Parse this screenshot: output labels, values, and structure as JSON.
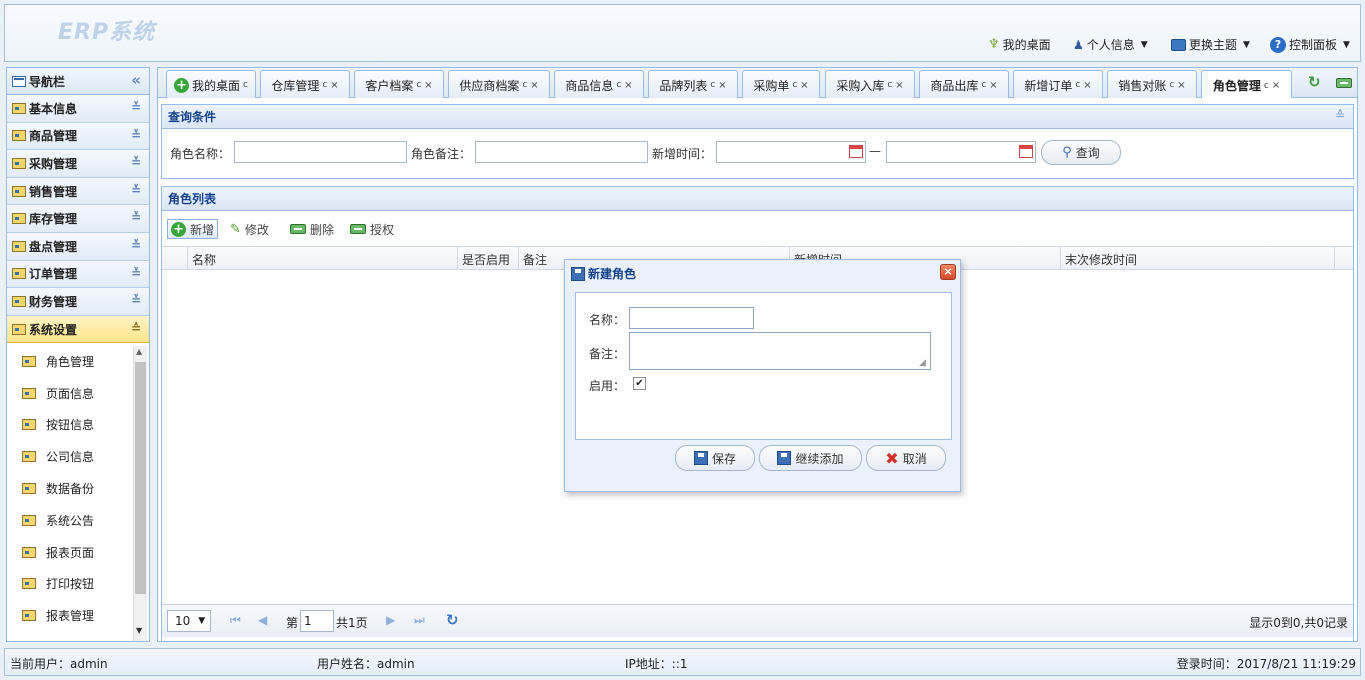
{
  "app": {
    "title": "ERP系统"
  },
  "header": {
    "links": [
      {
        "label": "我的桌面",
        "icon": "trophy-icon"
      },
      {
        "label": "个人信息",
        "icon": "user-icon"
      },
      {
        "label": "更换主题",
        "icon": "monitor-icon"
      },
      {
        "label": "控制面板",
        "icon": "help-icon"
      }
    ]
  },
  "sidebar": {
    "title": "导航栏",
    "collapse_glyph": "«",
    "groups": [
      {
        "label": "基本信息"
      },
      {
        "label": "商品管理"
      },
      {
        "label": "采购管理"
      },
      {
        "label": "销售管理"
      },
      {
        "label": "库存管理"
      },
      {
        "label": "盘点管理"
      },
      {
        "label": "订单管理"
      },
      {
        "label": "财务管理"
      },
      {
        "label": "系统设置"
      }
    ],
    "active_group": "系统设置",
    "sub_items": [
      {
        "label": "角色管理"
      },
      {
        "label": "页面信息"
      },
      {
        "label": "按钮信息"
      },
      {
        "label": "公司信息"
      },
      {
        "label": "数据备份"
      },
      {
        "label": "系统公告"
      },
      {
        "label": "报表页面"
      },
      {
        "label": "打印按钮"
      },
      {
        "label": "报表管理"
      }
    ]
  },
  "tabs": [
    {
      "label": "我的桌面",
      "closable": false
    },
    {
      "label": "仓库管理",
      "closable": true
    },
    {
      "label": "客户档案",
      "closable": true
    },
    {
      "label": "供应商档案",
      "closable": true
    },
    {
      "label": "商品信息",
      "closable": true
    },
    {
      "label": "品牌列表",
      "closable": true
    },
    {
      "label": "采购单",
      "closable": true
    },
    {
      "label": "采购入库",
      "closable": true
    },
    {
      "label": "商品出库",
      "closable": true
    },
    {
      "label": "新增订单",
      "closable": true
    },
    {
      "label": "销售对账",
      "closable": true
    },
    {
      "label": "角色管理",
      "closable": true,
      "active": true
    }
  ],
  "tab_glyphs": {
    "refresh": "c",
    "close": "×"
  },
  "query": {
    "title": "查询条件",
    "name_label": "角色名称：",
    "note_label": "角色备注：",
    "time_label": "新增时间：",
    "range_sep": "—",
    "search_button": "查询"
  },
  "list": {
    "title": "角色列表",
    "toolbar": {
      "add": "新增",
      "edit": "修改",
      "delete": "删除",
      "grant": "授权"
    },
    "columns": [
      "名称",
      "是否启用",
      "备注",
      "新增时间",
      "末次修改时间"
    ]
  },
  "pager": {
    "page_size": "10",
    "page_prefix": "第",
    "page_value": "1",
    "page_suffix": "共1页",
    "summary": "显示0到0,共0记录"
  },
  "dialog": {
    "title": "新建角色",
    "name_label": "名称：",
    "name_value": "",
    "note_label": "备注：",
    "note_value": "",
    "enable_label": "启用：",
    "enable_checked": true,
    "save": "保存",
    "save_continue": "继续添加",
    "cancel": "取消"
  },
  "status": {
    "current_user": "当前用户：admin",
    "user_name": "用户姓名：admin",
    "ip": "IP地址：::1",
    "login_time": "登录时间：2017/8/21 11:19:29"
  }
}
